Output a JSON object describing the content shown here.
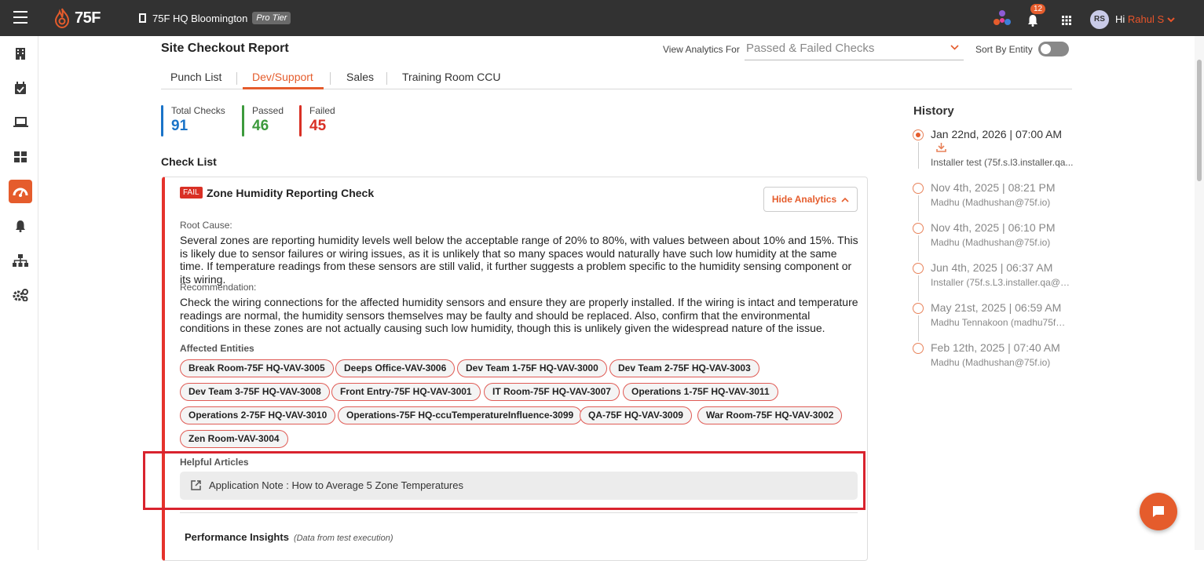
{
  "topbar": {
    "logo": "75F",
    "site_name": "75F HQ Bloomington",
    "tier": "Pro Tier",
    "notification_count": "12",
    "avatar_initials": "RS",
    "greeting": "Hi",
    "user_name": "Rahul S"
  },
  "sidebar": {
    "items": [
      "building-icon",
      "calendar-check-icon",
      "laptop-icon",
      "dashboard-icon",
      "gauge-icon",
      "bell-icon",
      "hierarchy-icon",
      "settings-icon"
    ],
    "active_index": 4
  },
  "page": {
    "title": "Site Checkout Report",
    "view_analytics_label": "View Analytics For",
    "view_analytics_value": "Passed & Failed Checks",
    "sort_label": "Sort By Entity",
    "sort_on": false
  },
  "tabs": [
    {
      "label": "Punch List",
      "active": false
    },
    {
      "label": "Dev/Support",
      "active": true
    },
    {
      "label": "Sales",
      "active": false
    },
    {
      "label": "Training Room CCU",
      "active": false
    }
  ],
  "stats": {
    "total": {
      "label": "Total Checks",
      "value": "91",
      "color": "#1a73c8"
    },
    "passed": {
      "label": "Passed",
      "value": "46",
      "color": "#3c9a3c"
    },
    "failed": {
      "label": "Failed",
      "value": "45",
      "color": "#d93025"
    }
  },
  "checklist": {
    "title": "Check List",
    "card": {
      "status": "FAIL",
      "title": "Zone Humidity Reporting Check",
      "hide_button": "Hide Analytics",
      "root_cause_label": "Root Cause:",
      "root_cause": "Several zones are reporting humidity levels well below the acceptable range of 20% to 80%, with values between about 10% and 15%. This is likely due to sensor failures or wiring issues, as it is unlikely that so many spaces would naturally have such low humidity at the same time. If temperature readings from these sensors are still valid, it further suggests a problem specific to the humidity sensing component or its wiring.",
      "recommendation_label": "Recommendation:",
      "recommendation": "Check the wiring connections for the affected humidity sensors and ensure they are properly installed. If the wiring is intact and temperature readings are normal, the humidity sensors themselves may be faulty and should be replaced. Also, confirm that the environmental conditions in these zones are not actually causing such low humidity, though this is unlikely given the widespread nature of the issue.",
      "affected_label": "Affected Entities",
      "entities": [
        "Break Room-75F HQ-VAV-3005",
        "Deeps Office-VAV-3006",
        "Dev Team 1-75F HQ-VAV-3000",
        "Dev Team 2-75F HQ-VAV-3003",
        "Dev Team 3-75F HQ-VAV-3008",
        "Front Entry-75F HQ-VAV-3001",
        "IT Room-75F HQ-VAV-3007",
        "Operations 1-75F HQ-VAV-3011",
        "Operations 2-75F HQ-VAV-3010",
        "Operations-75F HQ-ccuTemperatureInfluence-3099",
        "QA-75F HQ-VAV-3009",
        "War Room-75F HQ-VAV-3002",
        "Zen Room-VAV-3004"
      ],
      "articles_label": "Helpful Articles",
      "article": "Application Note : How to Average 5 Zone Temperatures",
      "perf_title": "Performance Insights",
      "perf_sub": "(Data from test execution)"
    }
  },
  "history": {
    "title": "History",
    "entries": [
      {
        "date": "Jan 22nd, 2026 | 07:00 AM",
        "user": "Installer test (75f.s.l3.installer.qa...",
        "active": true
      },
      {
        "date": "Nov 4th, 2025 | 08:21 PM",
        "user": "Madhu (Madhushan@75f.io)",
        "active": false
      },
      {
        "date": "Nov 4th, 2025 | 06:10 PM",
        "user": "Madhu (Madhushan@75f.io)",
        "active": false
      },
      {
        "date": "Jun 4th, 2025 | 06:37 AM",
        "user": "Installer (75f.s.L3.installer.qa@gm...",
        "active": false
      },
      {
        "date": "May 21st, 2025 | 06:59 AM",
        "user": "Madhu Tennakoon (madhu75f@g...",
        "active": false
      },
      {
        "date": "Feb 12th, 2025 | 07:40 AM",
        "user": "Madhu (Madhushan@75f.io)",
        "active": false
      }
    ]
  },
  "colors": {
    "accent": "#e55c2c",
    "fail": "#d93025",
    "topbar": "#323232"
  }
}
